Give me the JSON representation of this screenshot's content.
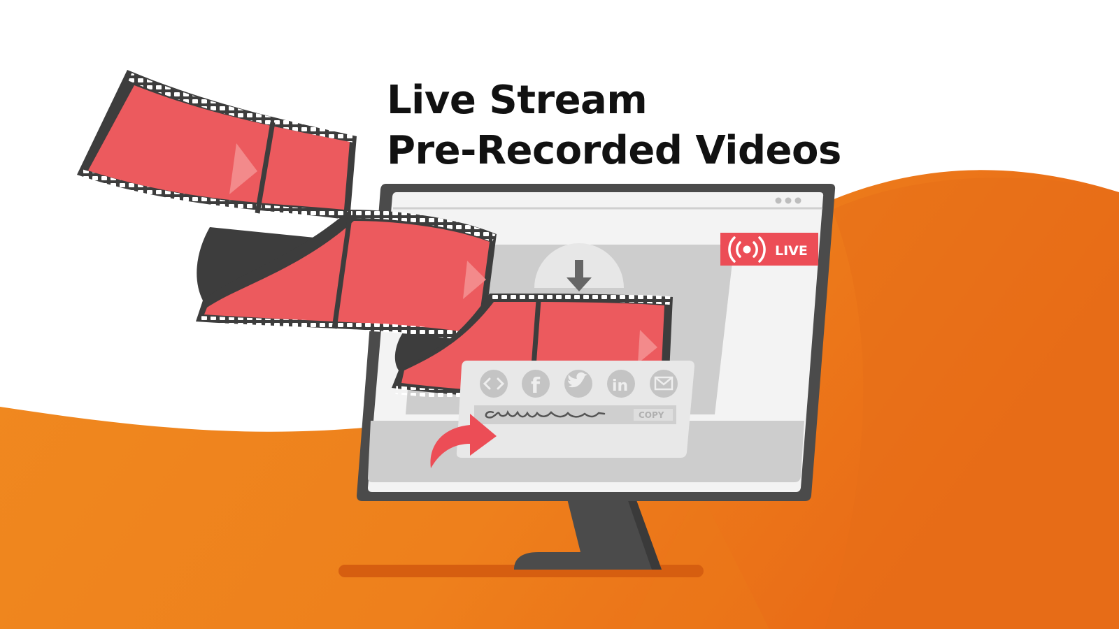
{
  "headline": {
    "line1": "Live Stream",
    "line2": "Pre-Recorded Videos"
  },
  "live_badge": {
    "label": "LIVE",
    "icon": "broadcast-icon"
  },
  "share_panel": {
    "icons": [
      "embed-code-icon",
      "facebook-icon",
      "twitter-icon",
      "linkedin-icon",
      "email-icon"
    ],
    "facebook_glyph": "f",
    "linkedin_glyph": "in",
    "copy_label": "COPY"
  },
  "colors": {
    "background": "#ffffff",
    "orange": "#ee8520",
    "film_red": "#ec5a5e",
    "monitor_dark": "#4b4b4b",
    "screen_gray": "#d2d2d2",
    "live_red": "#ec4d56",
    "text": "#111111"
  }
}
